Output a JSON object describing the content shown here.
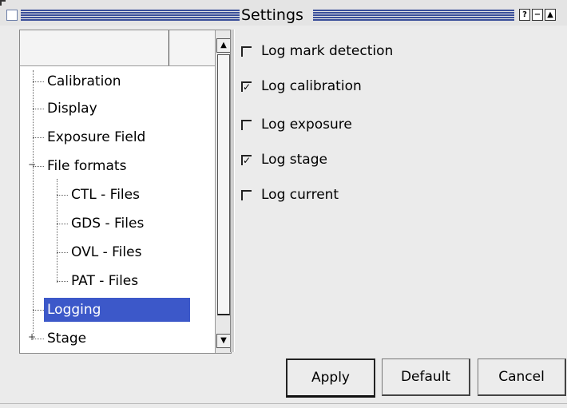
{
  "window": {
    "title": "Settings"
  },
  "titlebar_buttons": [
    "?",
    "−",
    "▲"
  ],
  "tree": {
    "items": [
      {
        "label": "Calibration",
        "level": 1
      },
      {
        "label": "Display",
        "level": 1
      },
      {
        "label": "Exposure Field",
        "level": 1
      },
      {
        "label": "File formats",
        "level": 1,
        "expanded": true
      },
      {
        "label": "CTL - Files",
        "level": 2
      },
      {
        "label": "GDS - Files",
        "level": 2
      },
      {
        "label": "OVL - Files",
        "level": 2
      },
      {
        "label": "PAT - Files",
        "level": 2
      },
      {
        "label": "Logging",
        "level": 1,
        "selected": true
      },
      {
        "label": "Stage",
        "level": 1,
        "collapsed": true
      }
    ]
  },
  "options": [
    {
      "label": "Log mark detection",
      "checked": false
    },
    {
      "label": "Log calibration",
      "checked": true
    },
    {
      "label": "Log exposure",
      "checked": false
    },
    {
      "label": "Log stage",
      "checked": true
    },
    {
      "label": "Log current",
      "checked": false
    }
  ],
  "buttons": {
    "apply": "Apply",
    "default": "Default",
    "cancel": "Cancel"
  },
  "colors": {
    "selection": "#3c58c9",
    "titlebar_stripes": "#3a4f9a"
  }
}
